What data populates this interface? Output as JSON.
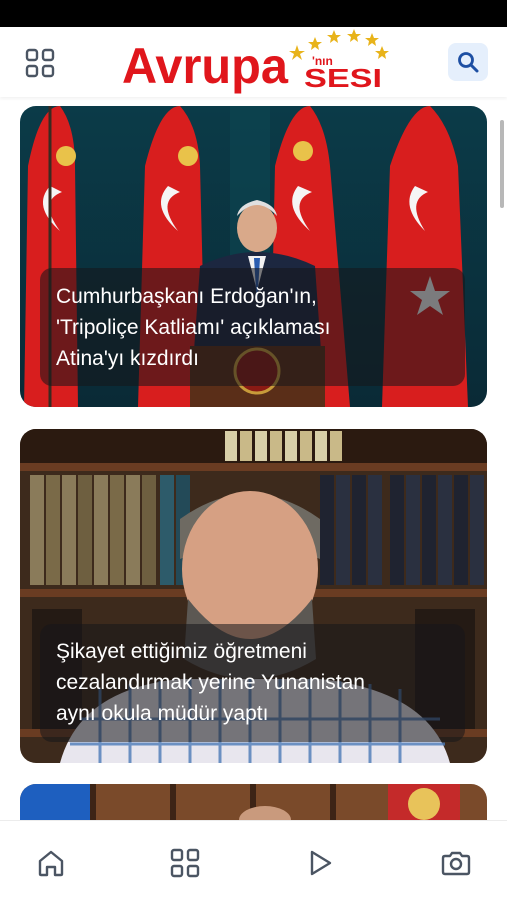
{
  "app": {
    "logo_text": "Avrupa'nın Sesi",
    "logo_main": "Avrupa",
    "logo_suffix": "'nın",
    "logo_sub": "SESI"
  },
  "header": {
    "menu_icon": "grid-icon",
    "search_icon": "search-icon"
  },
  "articles": [
    {
      "headline_lines": [
        "Cumhurbaşkanı Erdoğan'ın,",
        "'Tripoliçe Katliamı' açıklaması",
        "Atina'yı kızdırdı"
      ]
    },
    {
      "headline_lines": [
        "Şikayet ettiğimiz öğretmeni",
        "cezalandırmak yerine Yunanistan",
        "aynı okula müdür yaptı"
      ]
    }
  ],
  "bottom_nav": {
    "items": [
      "home-icon",
      "categories-icon",
      "video-play-icon",
      "camera-icon"
    ]
  },
  "colors": {
    "brand_red": "#e0161c",
    "brand_gold": "#e8b31a",
    "accent_blue": "#1d4fa3",
    "search_bg": "#e5effc",
    "icon_gray": "#4b5563"
  }
}
